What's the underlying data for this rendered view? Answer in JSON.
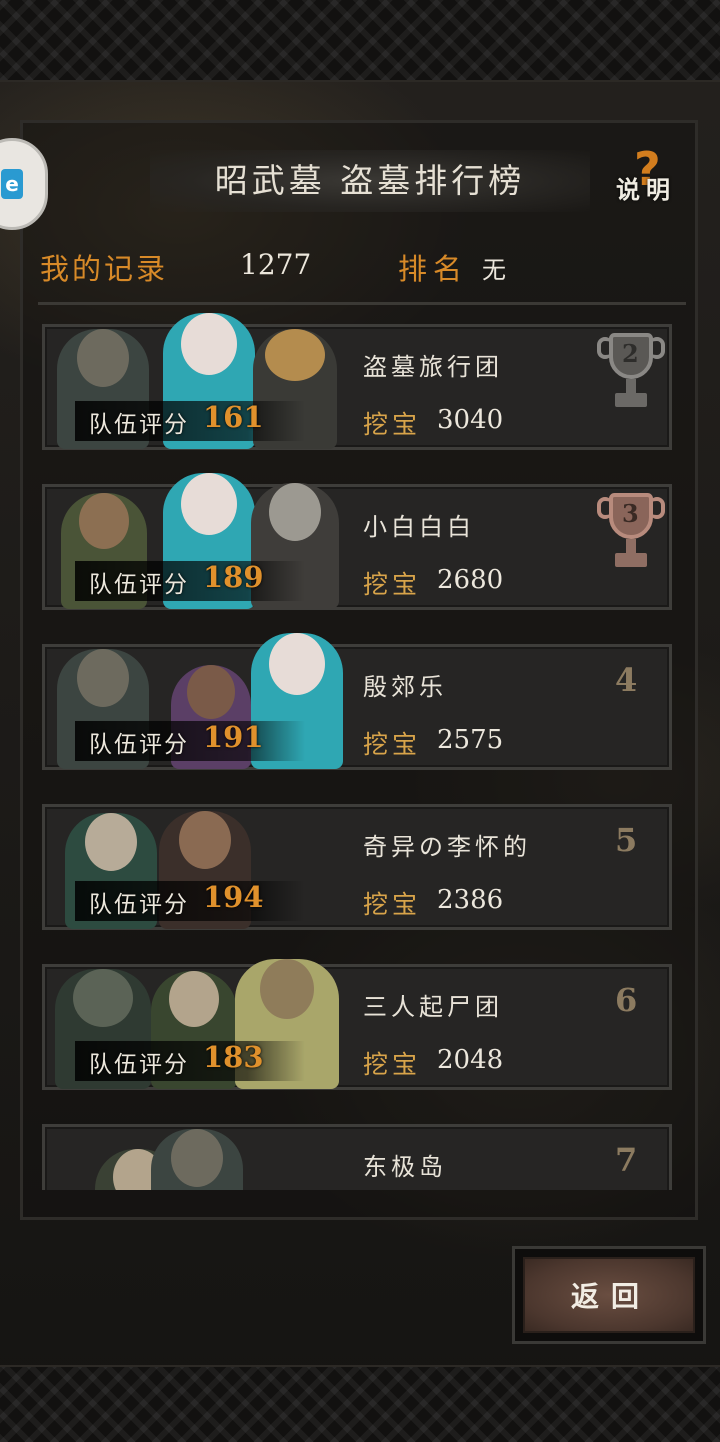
{
  "header": {
    "title": "昭武墓 盗墓排行榜",
    "help_label": "说明",
    "help_mark": "?"
  },
  "side_badge": {
    "text": "e"
  },
  "my_record": {
    "label": "我的记录",
    "value": "1277",
    "rank_label": "排名",
    "rank_value": "无"
  },
  "entries": [
    {
      "rank": "2",
      "trophy": "silver",
      "name": "盗墓旅行团",
      "score_label": "队伍评分",
      "score": "161",
      "dig_label": "挖宝",
      "dig_value": "3040"
    },
    {
      "rank": "3",
      "trophy": "bronze",
      "name": "小白白白",
      "score_label": "队伍评分",
      "score": "189",
      "dig_label": "挖宝",
      "dig_value": "2680"
    },
    {
      "rank": "4",
      "trophy": "",
      "name": "殷郊乐",
      "score_label": "队伍评分",
      "score": "191",
      "dig_label": "挖宝",
      "dig_value": "2575"
    },
    {
      "rank": "5",
      "trophy": "",
      "name": "奇异の李怀的",
      "score_label": "队伍评分",
      "score": "194",
      "dig_label": "挖宝",
      "dig_value": "2386"
    },
    {
      "rank": "6",
      "trophy": "",
      "name": "三人起尸团",
      "score_label": "队伍评分",
      "score": "183",
      "dig_label": "挖宝",
      "dig_value": "2048"
    },
    {
      "rank": "7",
      "trophy": "",
      "name": "东极岛",
      "score_label": "",
      "score": "",
      "dig_label": "",
      "dig_value": ""
    }
  ],
  "back_button": {
    "label": "返回"
  },
  "colors": {
    "accent_orange": "#d88a28",
    "score_orange": "#e0912c",
    "dig_gold": "#d8a44a",
    "card_bg": "#262524"
  }
}
